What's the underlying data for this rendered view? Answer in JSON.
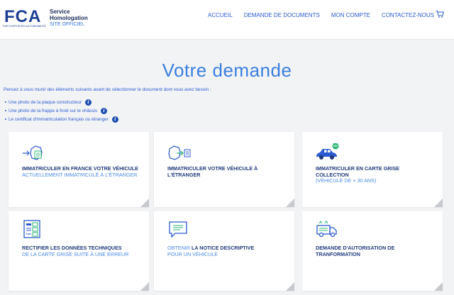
{
  "brand": {
    "logo_text": "FCA",
    "logo_sub": "FIAT CHRYSLER AUTOMOBILES",
    "service_line1": "Service",
    "service_line2": "Homologation",
    "official": "SITE OFFICIEL",
    "color": "#1c3f94"
  },
  "nav": {
    "items": [
      {
        "label": "ACCUEIL"
      },
      {
        "label": "DEMANDE DE DOCUMENTS"
      },
      {
        "label": "MON COMPTE"
      },
      {
        "label": "CONTACTEZ-NOUS"
      }
    ],
    "cart_icon": "cart-icon"
  },
  "page": {
    "title": "Votre demande",
    "intro": "Pensez à vous munir des éléments suivants avant de sélectionner le document dont vous avez besoin :",
    "requirements": [
      {
        "text": "Une photo de la plaque constructeur"
      },
      {
        "text": "Une photo de la frappe à froid sur le châssis"
      },
      {
        "text": "Le certificat d'immatriculation français ou étranger"
      }
    ],
    "info_glyph": "i"
  },
  "cards": [
    {
      "icon": "france-import-icon",
      "title": "IMMATRICULER EN FRANCE VOTRE VÉHICULE",
      "sub": "ACTUELLEMENT IMMATRICULÉ À L'ÉTRANGER"
    },
    {
      "icon": "france-export-icon",
      "title": "IMMATRICULER VOTRE VÉHICULE À L'ÉTRANGER",
      "sub": ""
    },
    {
      "icon": "vintage-car-icon",
      "badge": "+30",
      "title": "IMMATRICULER EN CARTE GRISE COLLECTION",
      "sub": "(VÉHICULE DE + 30 ANS)"
    },
    {
      "icon": "data-form-icon",
      "title": "RECTIFIER LES DONNÉES TECHNIQUES",
      "sub": "DE LA CARTE GRISE SUITE À UNE ERREUR"
    },
    {
      "icon": "notice-icon",
      "pre": "OBTENIR",
      "title": "LA NOTICE DESCRIPTIVE",
      "sub": "POUR UN VÉHICULE"
    },
    {
      "icon": "transformation-truck-icon",
      "title": "DEMANDE D'AUTORISATION DE TRANFORMATION",
      "sub": ""
    }
  ],
  "colors": {
    "accent": "#3a7fe0",
    "dark_blue": "#1f3a7a",
    "link": "#2a5ad0",
    "green_badge": "#2bb673"
  }
}
